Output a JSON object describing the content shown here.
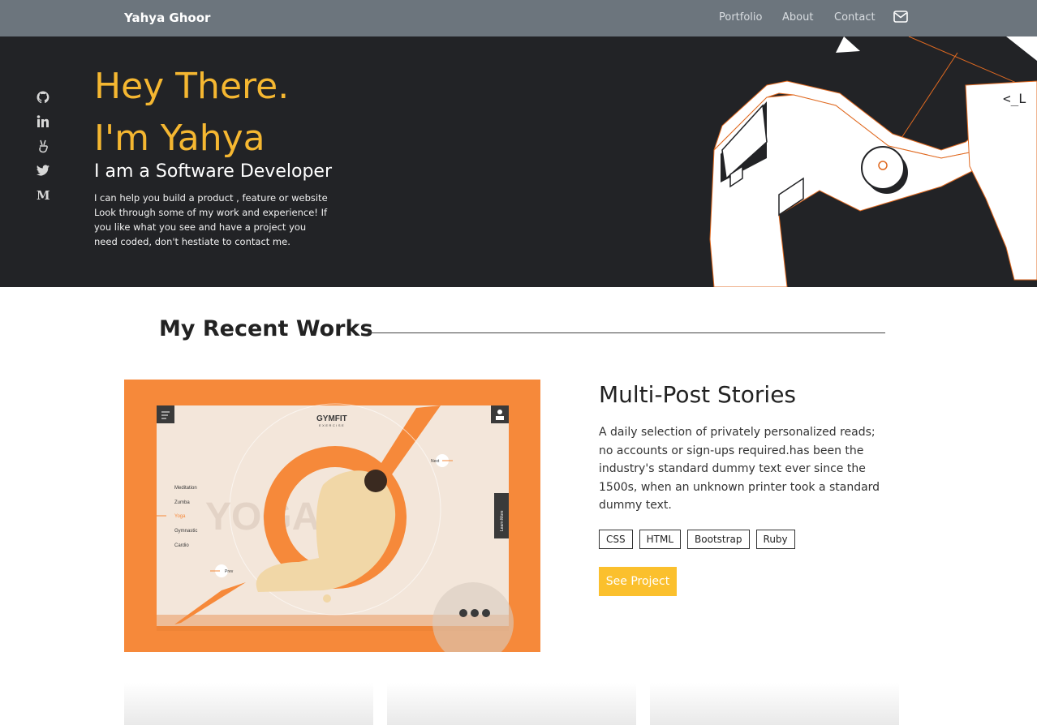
{
  "nav": {
    "brand": "Yahya Ghoor",
    "links": [
      "Portfolio",
      "About",
      "Contact"
    ],
    "mail_icon": "mail-icon"
  },
  "hero": {
    "line1": "Hey There.",
    "line2": "I'm Yahya",
    "subtitle": "I am a Software Developer",
    "text": "I can help you build a product , feature or website Look through some of my work and experience! If you like what you see and have a project you need coded, don't hestiate to contact me.",
    "socials": [
      "github-icon",
      "linkedin-icon",
      "angellist-icon",
      "twitter-icon",
      "medium-icon"
    ],
    "accent": "#f5b731",
    "background": "#222326"
  },
  "works": {
    "title": "My Recent Works",
    "featured": {
      "title": "Multi-Post Stories",
      "description": "A daily selection of privately personalized reads; no accounts or sign-ups required.has been the industry's standard dummy text ever since the 1500s, when an unknown printer took a standard dummy text.",
      "tags": [
        "CSS",
        "HTML",
        "Bootstrap",
        "Ruby"
      ],
      "button": "See Project",
      "button_color": "#fbc02d"
    },
    "mockup": {
      "logo": "GYMFIT",
      "logo_sub": "EXERCISE",
      "menu": [
        "Meditation",
        "Zumba",
        "Yoga",
        "Gymnastic",
        "Cardio"
      ],
      "big_word": "YOGA",
      "next": "Next",
      "prev": "Prev",
      "side": "Learn More",
      "accent": "#f6893a"
    }
  }
}
